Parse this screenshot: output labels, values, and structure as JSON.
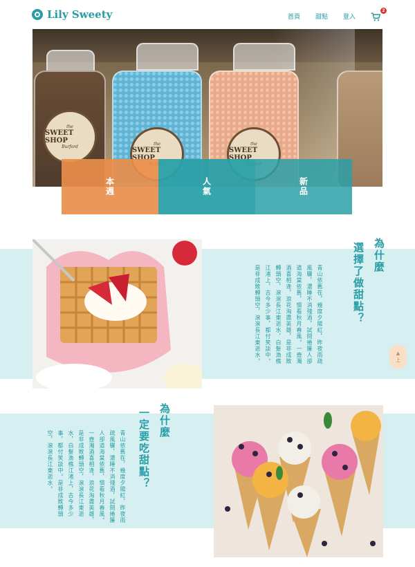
{
  "header": {
    "brand": "Lily Sweety",
    "nav": [
      "首頁",
      "甜點",
      "登入"
    ],
    "cart_count": "2"
  },
  "hero": {
    "jar_label_top": "the",
    "jar_label_main": "SWEET SHOP",
    "jar_label_bottom": "Burford",
    "categories": [
      "本週",
      "人氣",
      "新品"
    ]
  },
  "section1": {
    "title_line1": "為什麼",
    "title_line2": "選擇了做甜點？",
    "body": "青山依舊在，幾度夕陽紅，昨夜雨疏風驟，濃睡不消殘酒，試問捲簾人卻道海棠依舊，慣看秋月春風。一壺濁酒喜相逢，浪花淘盡英雄，是非成敗轉頭空，滾滾長江東逝水，白髮漁樵江渚上，古今多少事，都付笑談中。是非成敗轉頭空，滾滾長江東逝水。"
  },
  "section2": {
    "title_line1": "為什麼",
    "title_line2": "一定要吃甜點？",
    "body": "青山依舊在，幾度夕陽紅，昨夜雨疏風驟，濃睡不消殘酒，試問捲簾人卻道海棠依舊，慣看秋月春風。一壺濁酒喜相逢，浪花淘盡英雄，是非成敗轉頭空，滾滾長江東逝水，白髮漁樵江渚上，古今多少事，都付笑談中。是非成敗轉頭空，滾滾長江東逝水。"
  },
  "back_to_top": {
    "arrow": "▲",
    "label": "上"
  }
}
